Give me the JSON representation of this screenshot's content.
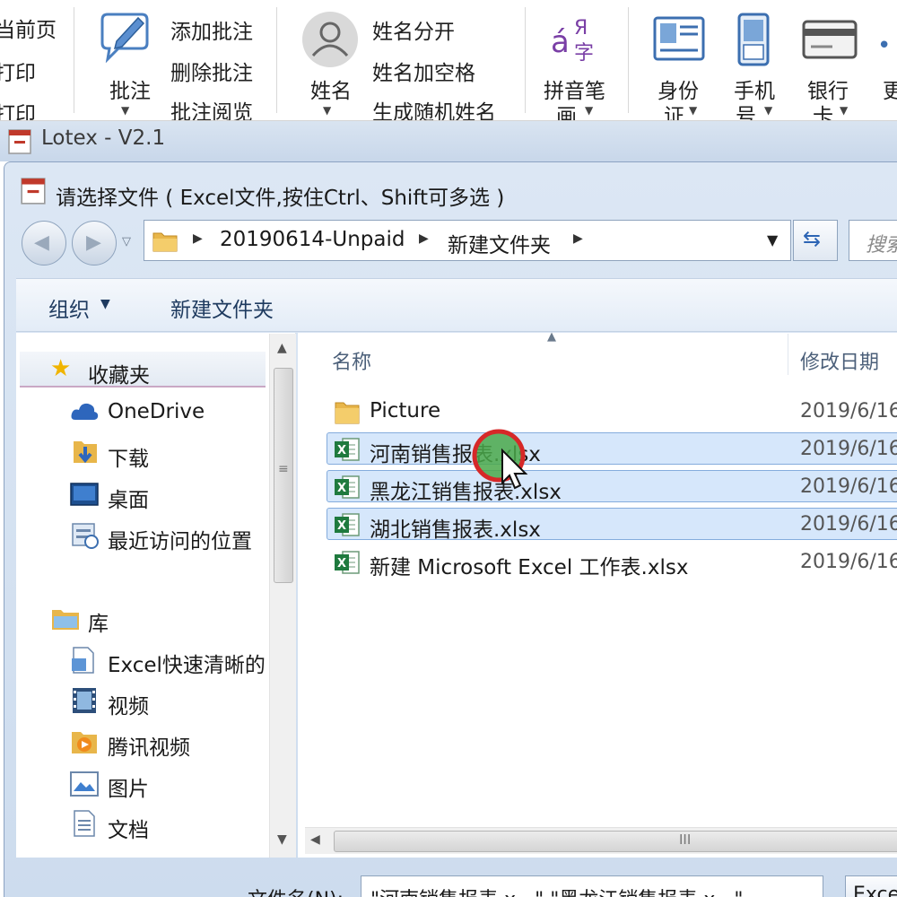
{
  "ribbon": {
    "left_items": [
      "当前页",
      "打印",
      "打印"
    ],
    "comment": {
      "label": "批注",
      "actions": [
        "添加批注",
        "删除批注",
        "批注阅览"
      ]
    },
    "name": {
      "label": "姓名",
      "actions": [
        "姓名分开",
        "姓名加空格",
        "生成随机姓名"
      ]
    },
    "pinyin": {
      "label_line1": "拼音笔",
      "label_line2": "画"
    },
    "idcard": {
      "label_line1": "身份",
      "label_line2": "证"
    },
    "phone": {
      "label_line1": "手机",
      "label_line2": "号"
    },
    "bank": {
      "label_line1": "银行",
      "label_line2": "卡"
    },
    "more": {
      "label": "更"
    }
  },
  "app": {
    "title": "Lotex - V2.1"
  },
  "dialog": {
    "title": "请选择文件 ( Excel文件,按住Ctrl、Shift可多选 )",
    "path": [
      "20190614-Unpaid",
      "新建文件夹"
    ],
    "search_placeholder": "搜索",
    "toolbar": {
      "organize": "组织",
      "new_folder": "新建文件夹"
    },
    "nav": {
      "favorites_header": "收藏夹",
      "favorites": [
        "OneDrive",
        "下载",
        "桌面",
        "最近访问的位置"
      ],
      "library_header": "库",
      "library": [
        "Excel快速清晰的",
        "视频",
        "腾讯视频",
        "图片",
        "文档"
      ]
    },
    "columns": {
      "name": "名称",
      "date": "修改日期"
    },
    "files": [
      {
        "name": "Picture",
        "date": "2019/6/16",
        "type": "folder"
      },
      {
        "name": "河南销售报表.xlsx",
        "date": "2019/6/16",
        "type": "xlsx"
      },
      {
        "name": "黑龙江销售报表.xlsx",
        "date": "2019/6/16",
        "type": "xlsx"
      },
      {
        "name": "湖北销售报表.xlsx",
        "date": "2019/6/16",
        "type": "xlsx"
      },
      {
        "name": "新建 Microsoft Excel 工作表.xlsx",
        "date": "2019/6/16",
        "type": "xlsx"
      }
    ],
    "filename": {
      "label": "文件名(N):",
      "value": "\"河南销售报表.x...\" \"黑龙江销售报表.x...\""
    },
    "filetype": "Excel"
  },
  "colors": {
    "selection": "#d6e7fb",
    "selection_border": "#84acdd",
    "excel_green": "#1f7a3e",
    "folder": "#e8b64a",
    "cursor_ring": "#d62828",
    "cursor_fill": "#4aa84a"
  }
}
